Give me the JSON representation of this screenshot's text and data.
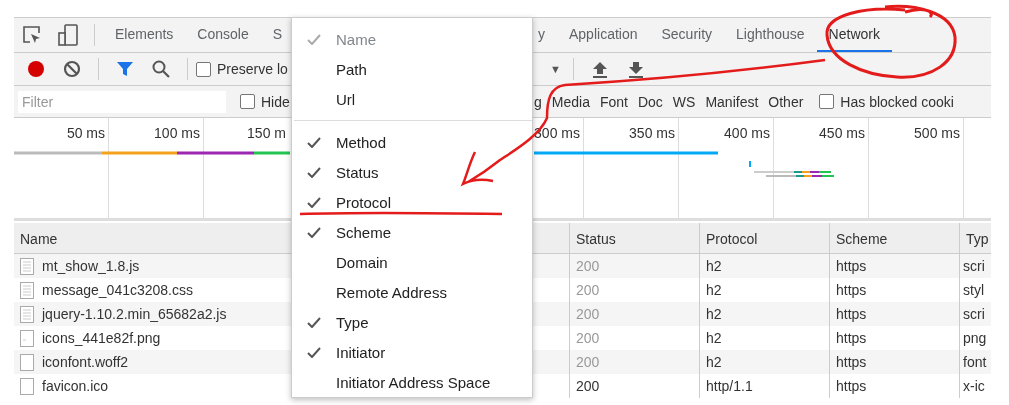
{
  "tabs": [
    {
      "label": "Elements",
      "selected": false
    },
    {
      "label": "Console",
      "selected": false
    },
    {
      "label": "S",
      "selected": false
    },
    {
      "label": "y",
      "selected": false
    },
    {
      "label": "Application",
      "selected": false
    },
    {
      "label": "Security",
      "selected": false
    },
    {
      "label": "Lighthouse",
      "selected": false
    },
    {
      "label": "Network",
      "selected": true
    }
  ],
  "toolbar": {
    "recording": true,
    "preserve_log": {
      "label": "Preserve lo",
      "checked": false
    },
    "caret": "▼"
  },
  "filter_bar": {
    "placeholder": "Filter",
    "hide": {
      "label": "Hide",
      "checked": false
    },
    "types": [
      "g",
      "Media",
      "Font",
      "Doc",
      "WS",
      "Manifest",
      "Other"
    ],
    "blocked": {
      "label": "Has blocked cooki",
      "checked": false
    }
  },
  "timeline": {
    "ticks": [
      "50 ms",
      "100 ms",
      "150 m",
      "300 ms",
      "350 ms",
      "400 ms",
      "450 ms",
      "500 ms"
    ]
  },
  "table": {
    "columns": [
      "Name",
      "Status",
      "Protocol",
      "Scheme",
      "Typ"
    ],
    "rows": [
      {
        "name": "mt_show_1.8.js",
        "kind": "script",
        "status": "200",
        "dimmed": true,
        "protocol": "h2",
        "scheme": "https",
        "type": "scri"
      },
      {
        "name": "message_041c3208.css",
        "kind": "script",
        "status": "200",
        "dimmed": true,
        "protocol": "h2",
        "scheme": "https",
        "type": "styl"
      },
      {
        "name": "jquery-1.10.2.min_65682a2.js",
        "kind": "script",
        "status": "200",
        "dimmed": true,
        "protocol": "h2",
        "scheme": "https",
        "type": "scri"
      },
      {
        "name": "icons_441e82f.png",
        "kind": "image",
        "status": "200",
        "dimmed": true,
        "protocol": "h2",
        "scheme": "https",
        "type": "png"
      },
      {
        "name": "iconfont.woff2",
        "kind": "blank",
        "status": "200",
        "dimmed": true,
        "protocol": "h2",
        "scheme": "https",
        "type": "font"
      },
      {
        "name": "favicon.ico",
        "kind": "blank",
        "status": "200",
        "dimmed": false,
        "protocol": "http/1.1",
        "scheme": "https",
        "type": "x-ic"
      }
    ]
  },
  "context_menu": {
    "sections": [
      [
        {
          "label": "Name",
          "checked": true,
          "disabled": true
        },
        {
          "label": "Path",
          "checked": false,
          "disabled": false
        },
        {
          "label": "Url",
          "checked": false,
          "disabled": false
        }
      ],
      [
        {
          "label": "Method",
          "checked": true,
          "disabled": false
        },
        {
          "label": "Status",
          "checked": true,
          "disabled": false
        },
        {
          "label": "Protocol",
          "checked": true,
          "disabled": false
        },
        {
          "label": "Scheme",
          "checked": true,
          "disabled": false
        },
        {
          "label": "Domain",
          "checked": false,
          "disabled": false
        },
        {
          "label": "Remote Address",
          "checked": false,
          "disabled": false
        },
        {
          "label": "Type",
          "checked": true,
          "disabled": false
        },
        {
          "label": "Initiator",
          "checked": true,
          "disabled": false
        },
        {
          "label": "Initiator Address Space",
          "checked": false,
          "disabled": false
        }
      ]
    ]
  }
}
